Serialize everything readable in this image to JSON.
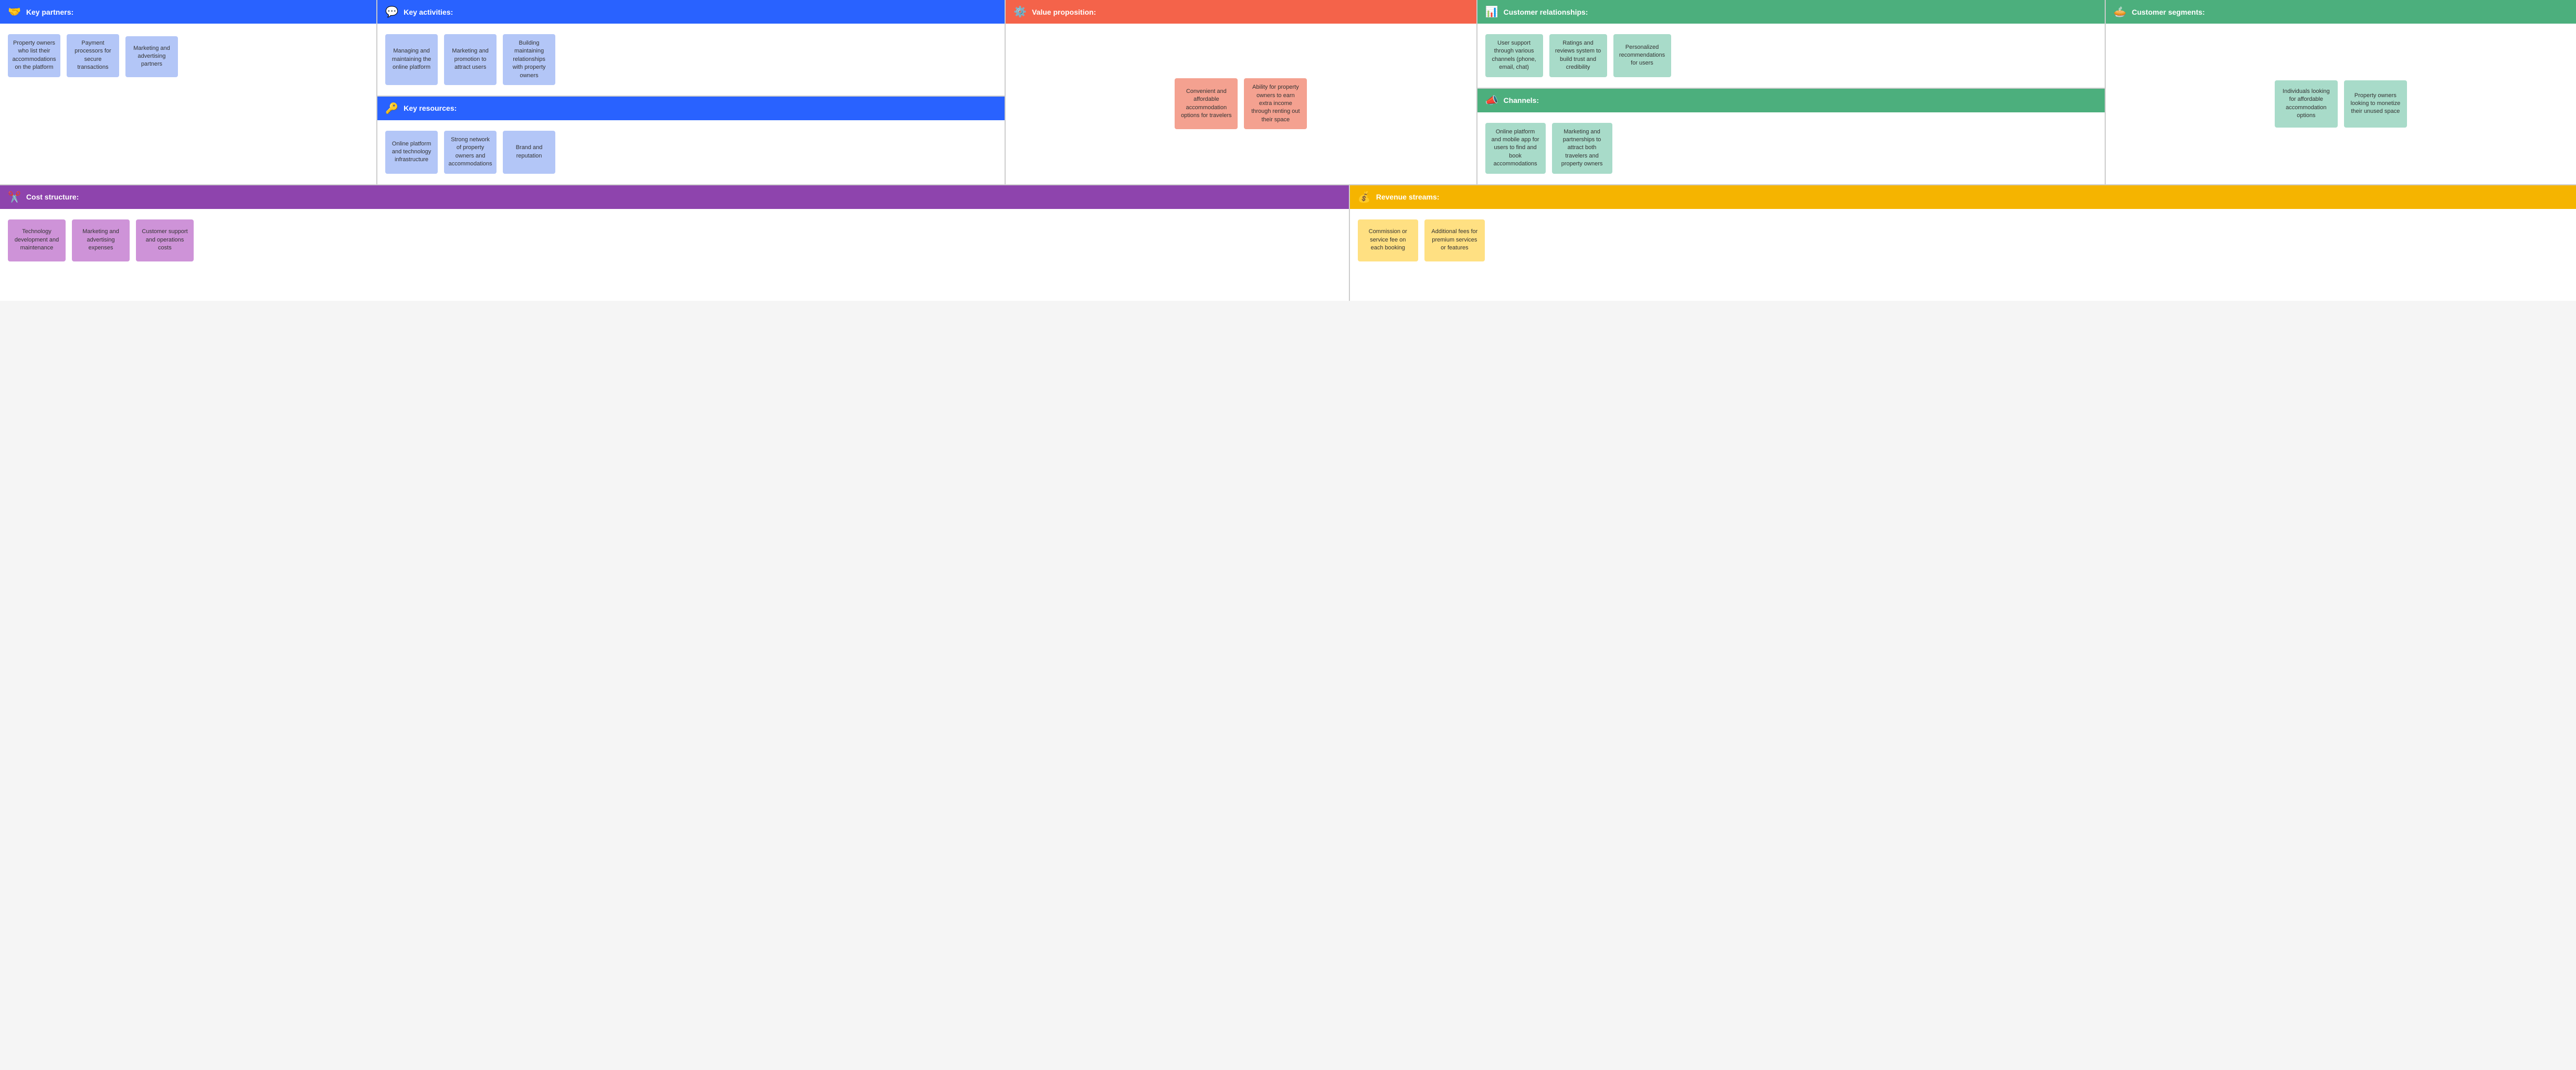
{
  "sections": {
    "keyPartners": {
      "title": "Key partners:",
      "icon": "🤝",
      "headerClass": "header-blue",
      "notes": [
        {
          "text": "Property owners who list their accommodations on the platform",
          "class": "note-blue"
        },
        {
          "text": "Payment processors for secure transactions",
          "class": "note-blue"
        },
        {
          "text": "Marketing and advertising partners",
          "class": "note-blue"
        }
      ]
    },
    "keyActivities": {
      "title": "Key activities:",
      "icon": "💬",
      "headerClass": "header-blue",
      "notes": [
        {
          "text": "Managing and maintaining the online platform",
          "class": "note-blue"
        },
        {
          "text": "Marketing and promotion to attract users",
          "class": "note-blue"
        },
        {
          "text": "Building maintaining relationships with property owners",
          "class": "note-blue"
        }
      ]
    },
    "keyResources": {
      "title": "Key resources:",
      "icon": "🔑",
      "headerClass": "header-blue",
      "notes": [
        {
          "text": "Online platform and technology infrastructure",
          "class": "note-blue"
        },
        {
          "text": "Strong network of property owners and accommodations",
          "class": "note-blue"
        },
        {
          "text": "Brand and reputation",
          "class": "note-blue"
        }
      ]
    },
    "valueProposition": {
      "title": "Value proposition:",
      "icon": "⚙️",
      "headerClass": "header-red",
      "notes": [
        {
          "text": "Convenient and affordable accommodation options for travelers",
          "class": "note-red"
        },
        {
          "text": "Ability for property owners to earn extra income through renting out their space",
          "class": "note-red"
        }
      ]
    },
    "customerRelationships": {
      "title": "Customer relationships:",
      "icon": "📊",
      "headerClass": "header-green",
      "notes": [
        {
          "text": "User support through various channels (phone, email, chat)",
          "class": "note-green"
        },
        {
          "text": "Ratings and reviews system to build trust and credibility",
          "class": "note-green"
        },
        {
          "text": "Personalized recommendations for users",
          "class": "note-green"
        }
      ]
    },
    "channels": {
      "title": "Channels:",
      "icon": "📣",
      "headerClass": "header-green",
      "notes": [
        {
          "text": "Online platform and mobile app for users to find and book accommodations",
          "class": "note-green"
        },
        {
          "text": "Marketing and partnerships to attract both travelers and property owners",
          "class": "note-green"
        }
      ]
    },
    "customerSegments": {
      "title": "Customer segments:",
      "icon": "🥧",
      "headerClass": "header-green",
      "notes": [
        {
          "text": "Individuals looking for affordable accommodation options",
          "class": "note-green"
        },
        {
          "text": "Property owners looking to monetize their unused space",
          "class": "note-green"
        }
      ]
    },
    "costStructure": {
      "title": "Cost structure:",
      "icon": "✂️",
      "headerClass": "header-purple",
      "notes": [
        {
          "text": "Technology development and maintenance",
          "class": "note-purple"
        },
        {
          "text": "Marketing and advertising expenses",
          "class": "note-purple"
        },
        {
          "text": "Customer support and operations costs",
          "class": "note-purple"
        }
      ]
    },
    "revenueStreams": {
      "title": "Revenue streams:",
      "icon": "💰",
      "headerClass": "header-yellow",
      "notes": [
        {
          "text": "Commission or service fee on each booking",
          "class": "note-yellow"
        },
        {
          "text": "Additional fees for premium services or features",
          "class": "note-yellow"
        }
      ]
    }
  }
}
